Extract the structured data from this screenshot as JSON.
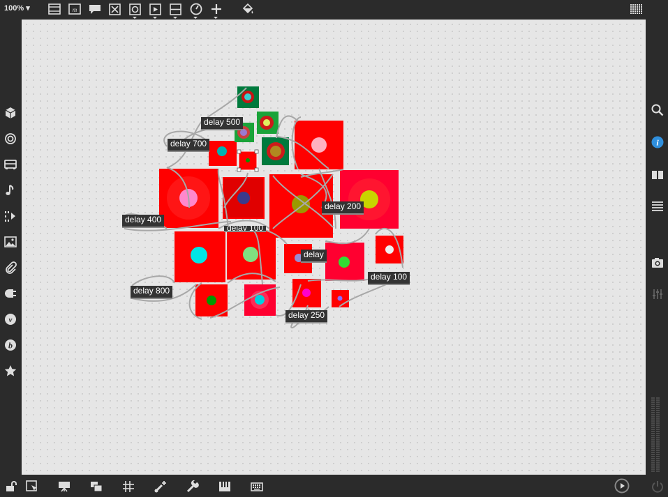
{
  "toolbar": {
    "zoom": "100%",
    "icons": [
      "presentation-icon",
      "message-icon",
      "comment-icon",
      "toggle-icon",
      "bang-icon",
      "button-icon",
      "slider-icon",
      "dial-icon",
      "add-icon",
      "paint-bucket-icon",
      "grid-menu-icon"
    ]
  },
  "left_sidebar": {
    "icons": [
      "cube-icon",
      "circle-target-icon",
      "bus-icon",
      "music-note-icon",
      "sequencer-icon",
      "image-icon",
      "paperclip-icon",
      "plug-icon",
      "vimeo-icon",
      "bold-b-icon",
      "star-icon"
    ]
  },
  "right_sidebar": {
    "icons": [
      "search-icon",
      "info-icon",
      "book-icon",
      "list-icon",
      "camera-icon",
      "mixer-icon"
    ]
  },
  "bottom_bar": {
    "icons": [
      "lock-icon",
      "cursor-edit-icon",
      "presentation-icon",
      "windows-icon",
      "grid-icon",
      "patch-add-icon",
      "wrench-icon",
      "piano-icon",
      "keyboard-icon",
      "play-icon",
      "power-icon"
    ]
  },
  "patch": {
    "labels": {
      "d500": "delay 500",
      "d700": "delay 700",
      "d400": "delay 400",
      "d100a": "delay 100",
      "d200": "delay 200",
      "dpart": "delay",
      "d100b": "delay 100",
      "d800": "delay 800",
      "d250": "delay 250"
    },
    "colors": {
      "red": "#ff0000",
      "green": "#007a3d",
      "cord": "#a8a8a8"
    }
  }
}
